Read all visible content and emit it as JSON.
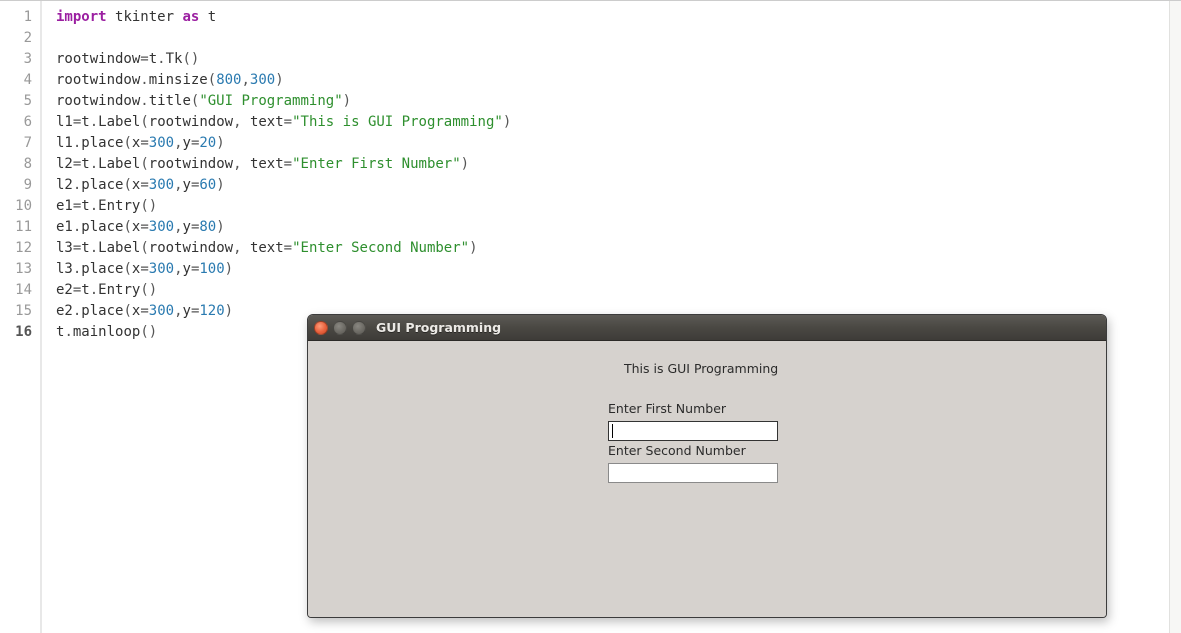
{
  "editor": {
    "lines": [
      {
        "n": 1,
        "tokens": [
          [
            "kw",
            "import"
          ],
          [
            "sp",
            " "
          ],
          [
            "ident",
            "tkinter"
          ],
          [
            "sp",
            " "
          ],
          [
            "kw",
            "as"
          ],
          [
            "sp",
            " "
          ],
          [
            "ident",
            "t"
          ]
        ]
      },
      {
        "n": 2,
        "tokens": []
      },
      {
        "n": 3,
        "tokens": [
          [
            "ident",
            "rootwindow"
          ],
          [
            "op",
            "="
          ],
          [
            "ident",
            "t"
          ],
          [
            "dot",
            "."
          ],
          [
            "ident",
            "Tk"
          ],
          [
            "paren",
            "("
          ],
          [
            "paren",
            ")"
          ]
        ]
      },
      {
        "n": 4,
        "tokens": [
          [
            "ident",
            "rootwindow"
          ],
          [
            "dot",
            "."
          ],
          [
            "ident",
            "minsize"
          ],
          [
            "paren",
            "("
          ],
          [
            "num",
            "800"
          ],
          [
            "op",
            ","
          ],
          [
            "num",
            "300"
          ],
          [
            "paren",
            ")"
          ]
        ]
      },
      {
        "n": 5,
        "tokens": [
          [
            "ident",
            "rootwindow"
          ],
          [
            "dot",
            "."
          ],
          [
            "ident",
            "title"
          ],
          [
            "paren",
            "("
          ],
          [
            "str",
            "\"GUI Programming\""
          ],
          [
            "paren",
            ")"
          ]
        ]
      },
      {
        "n": 6,
        "tokens": [
          [
            "ident",
            "l1"
          ],
          [
            "op",
            "="
          ],
          [
            "ident",
            "t"
          ],
          [
            "dot",
            "."
          ],
          [
            "ident",
            "Label"
          ],
          [
            "paren",
            "("
          ],
          [
            "ident",
            "rootwindow"
          ],
          [
            "op",
            ","
          ],
          [
            "sp",
            " "
          ],
          [
            "ident",
            "text"
          ],
          [
            "op",
            "="
          ],
          [
            "str",
            "\"This is GUI Programming\""
          ],
          [
            "paren",
            ")"
          ]
        ]
      },
      {
        "n": 7,
        "tokens": [
          [
            "ident",
            "l1"
          ],
          [
            "dot",
            "."
          ],
          [
            "ident",
            "place"
          ],
          [
            "paren",
            "("
          ],
          [
            "ident",
            "x"
          ],
          [
            "op",
            "="
          ],
          [
            "num",
            "300"
          ],
          [
            "op",
            ","
          ],
          [
            "ident",
            "y"
          ],
          [
            "op",
            "="
          ],
          [
            "num",
            "20"
          ],
          [
            "paren",
            ")"
          ]
        ]
      },
      {
        "n": 8,
        "tokens": [
          [
            "ident",
            "l2"
          ],
          [
            "op",
            "="
          ],
          [
            "ident",
            "t"
          ],
          [
            "dot",
            "."
          ],
          [
            "ident",
            "Label"
          ],
          [
            "paren",
            "("
          ],
          [
            "ident",
            "rootwindow"
          ],
          [
            "op",
            ","
          ],
          [
            "sp",
            " "
          ],
          [
            "ident",
            "text"
          ],
          [
            "op",
            "="
          ],
          [
            "str",
            "\"Enter First Number\""
          ],
          [
            "paren",
            ")"
          ]
        ]
      },
      {
        "n": 9,
        "tokens": [
          [
            "ident",
            "l2"
          ],
          [
            "dot",
            "."
          ],
          [
            "ident",
            "place"
          ],
          [
            "paren",
            "("
          ],
          [
            "ident",
            "x"
          ],
          [
            "op",
            "="
          ],
          [
            "num",
            "300"
          ],
          [
            "op",
            ","
          ],
          [
            "ident",
            "y"
          ],
          [
            "op",
            "="
          ],
          [
            "num",
            "60"
          ],
          [
            "paren",
            ")"
          ]
        ]
      },
      {
        "n": 10,
        "tokens": [
          [
            "ident",
            "e1"
          ],
          [
            "op",
            "="
          ],
          [
            "ident",
            "t"
          ],
          [
            "dot",
            "."
          ],
          [
            "ident",
            "Entry"
          ],
          [
            "paren",
            "("
          ],
          [
            "paren",
            ")"
          ]
        ]
      },
      {
        "n": 11,
        "tokens": [
          [
            "ident",
            "e1"
          ],
          [
            "dot",
            "."
          ],
          [
            "ident",
            "place"
          ],
          [
            "paren",
            "("
          ],
          [
            "ident",
            "x"
          ],
          [
            "op",
            "="
          ],
          [
            "num",
            "300"
          ],
          [
            "op",
            ","
          ],
          [
            "ident",
            "y"
          ],
          [
            "op",
            "="
          ],
          [
            "num",
            "80"
          ],
          [
            "paren",
            ")"
          ]
        ]
      },
      {
        "n": 12,
        "tokens": [
          [
            "ident",
            "l3"
          ],
          [
            "op",
            "="
          ],
          [
            "ident",
            "t"
          ],
          [
            "dot",
            "."
          ],
          [
            "ident",
            "Label"
          ],
          [
            "paren",
            "("
          ],
          [
            "ident",
            "rootwindow"
          ],
          [
            "op",
            ","
          ],
          [
            "sp",
            " "
          ],
          [
            "ident",
            "text"
          ],
          [
            "op",
            "="
          ],
          [
            "str",
            "\"Enter Second Number\""
          ],
          [
            "paren",
            ")"
          ]
        ]
      },
      {
        "n": 13,
        "tokens": [
          [
            "ident",
            "l3"
          ],
          [
            "dot",
            "."
          ],
          [
            "ident",
            "place"
          ],
          [
            "paren",
            "("
          ],
          [
            "ident",
            "x"
          ],
          [
            "op",
            "="
          ],
          [
            "num",
            "300"
          ],
          [
            "op",
            ","
          ],
          [
            "ident",
            "y"
          ],
          [
            "op",
            "="
          ],
          [
            "num",
            "100"
          ],
          [
            "paren",
            ")"
          ]
        ]
      },
      {
        "n": 14,
        "tokens": [
          [
            "ident",
            "e2"
          ],
          [
            "op",
            "="
          ],
          [
            "ident",
            "t"
          ],
          [
            "dot",
            "."
          ],
          [
            "ident",
            "Entry"
          ],
          [
            "paren",
            "("
          ],
          [
            "paren",
            ")"
          ]
        ]
      },
      {
        "n": 15,
        "tokens": [
          [
            "ident",
            "e2"
          ],
          [
            "dot",
            "."
          ],
          [
            "ident",
            "place"
          ],
          [
            "paren",
            "("
          ],
          [
            "ident",
            "x"
          ],
          [
            "op",
            "="
          ],
          [
            "num",
            "300"
          ],
          [
            "op",
            ","
          ],
          [
            "ident",
            "y"
          ],
          [
            "op",
            "="
          ],
          [
            "num",
            "120"
          ],
          [
            "paren",
            ")"
          ]
        ]
      },
      {
        "n": 16,
        "tokens": [
          [
            "ident",
            "t"
          ],
          [
            "dot",
            "."
          ],
          [
            "ident",
            "mainloop"
          ],
          [
            "paren",
            "("
          ],
          [
            "paren",
            ")"
          ]
        ]
      }
    ],
    "current_line": 16
  },
  "tkwindow": {
    "title": "GUI Programming",
    "labels": {
      "heading": "This is GUI Programming",
      "first": "Enter First Number",
      "second": "Enter Second Number"
    },
    "entries": {
      "e1_value": "",
      "e2_value": ""
    }
  }
}
